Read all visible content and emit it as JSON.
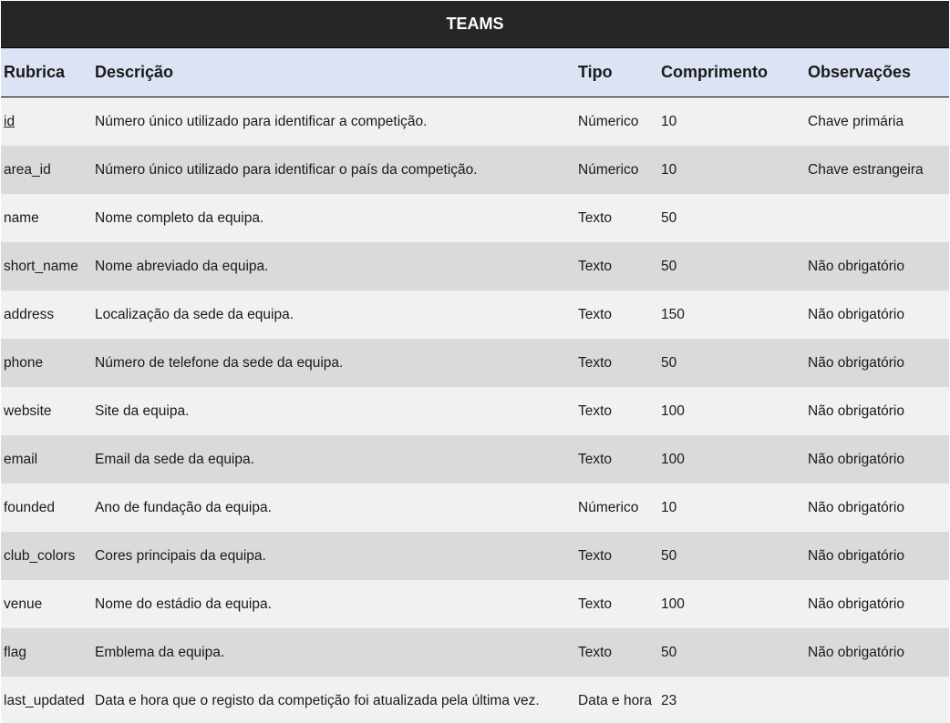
{
  "table": {
    "title": "TEAMS",
    "headers": {
      "rubrica": "Rubrica",
      "descricao": "Descrição",
      "tipo": "Tipo",
      "comprimento": "Comprimento",
      "observacoes": "Observações"
    },
    "rows": [
      {
        "rubrica": "id",
        "descricao": "Número único utilizado para identificar a competição.",
        "tipo": "Númerico",
        "comprimento": "10",
        "observacoes": "Chave primária"
      },
      {
        "rubrica": "area_id",
        "descricao": "Número único utilizado para identificar o país da competição.",
        "tipo": "Númerico",
        "comprimento": "10",
        "observacoes": "Chave estrangeira"
      },
      {
        "rubrica": "name",
        "descricao": "Nome completo da equipa.",
        "tipo": "Texto",
        "comprimento": "50",
        "observacoes": ""
      },
      {
        "rubrica": "short_name",
        "descricao": "Nome abreviado da equipa.",
        "tipo": "Texto",
        "comprimento": "50",
        "observacoes": "Não obrigatório"
      },
      {
        "rubrica": "address",
        "descricao": "Localização da sede da equipa.",
        "tipo": "Texto",
        "comprimento": "150",
        "observacoes": "Não obrigatório"
      },
      {
        "rubrica": "phone",
        "descricao": "Número de telefone da sede da equipa.",
        "tipo": "Texto",
        "comprimento": "50",
        "observacoes": "Não obrigatório"
      },
      {
        "rubrica": "website",
        "descricao": "Site da equipa.",
        "tipo": "Texto",
        "comprimento": "100",
        "observacoes": "Não obrigatório"
      },
      {
        "rubrica": "email",
        "descricao": "Email da sede da equipa.",
        "tipo": "Texto",
        "comprimento": "100",
        "observacoes": "Não obrigatório"
      },
      {
        "rubrica": "founded",
        "descricao": "Ano de fundação da equipa.",
        "tipo": "Númerico",
        "comprimento": "10",
        "observacoes": "Não obrigatório"
      },
      {
        "rubrica": "club_colors",
        "descricao": "Cores principais da equipa.",
        "tipo": "Texto",
        "comprimento": "50",
        "observacoes": "Não obrigatório"
      },
      {
        "rubrica": "venue",
        "descricao": "Nome do estádio da equipa.",
        "tipo": "Texto",
        "comprimento": "100",
        "observacoes": "Não obrigatório"
      },
      {
        "rubrica": "flag",
        "descricao": "Emblema da equipa.",
        "tipo": "Texto",
        "comprimento": "50",
        "observacoes": "Não obrigatório"
      },
      {
        "rubrica": "last_updated",
        "descricao": "Data e hora que o registo da competição foi atualizada pela última vez.",
        "tipo": "Data e hora",
        "comprimento": "23",
        "observacoes": ""
      }
    ]
  },
  "colors": {
    "title_bg": "#262626",
    "header_bg": "#dbe3f5",
    "row_light": "#f1f1f1",
    "row_dark": "#dadada"
  }
}
